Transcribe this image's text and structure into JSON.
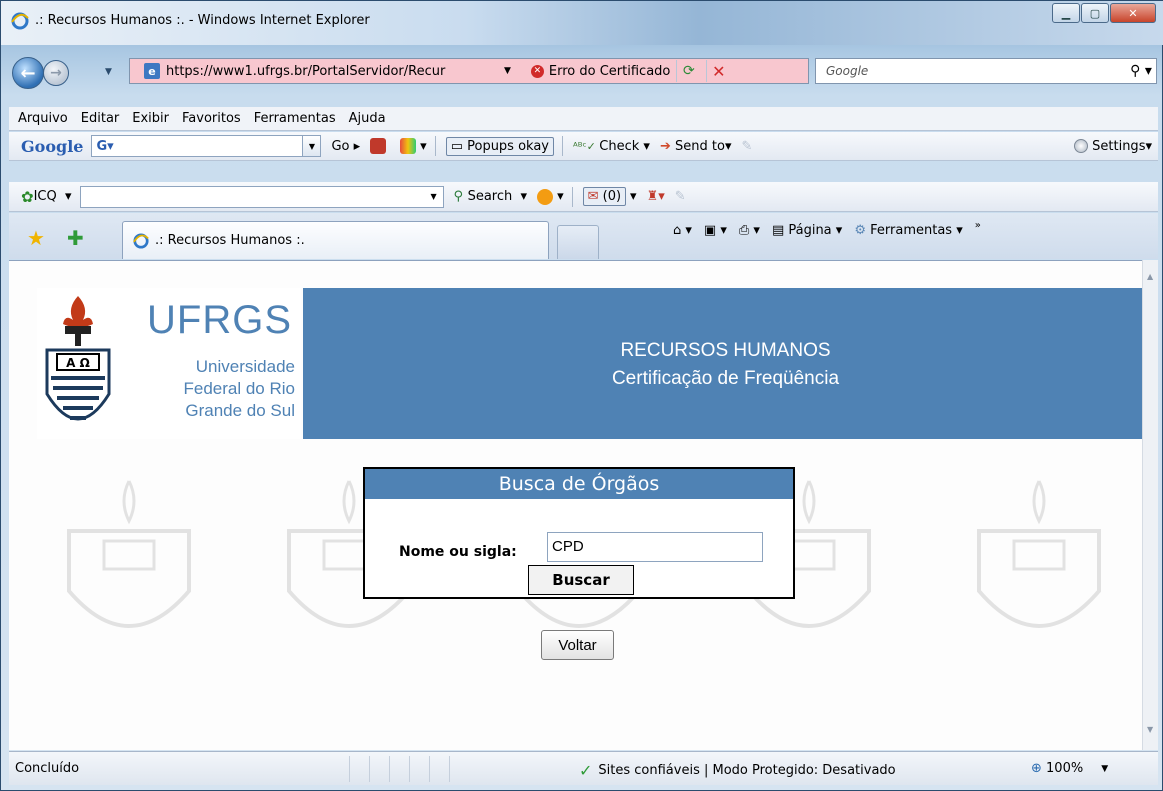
{
  "window": {
    "title": ".: Recursos Humanos :. - Windows Internet Explorer"
  },
  "address_bar": {
    "url": "https://www1.ufrgs.br/PortalServidor/Recur",
    "certificate_error": "Erro do Certificado",
    "search_placeholder": "Google"
  },
  "menu": {
    "items": [
      "Arquivo",
      "Editar",
      "Exibir",
      "Favoritos",
      "Ferramentas",
      "Ajuda"
    ]
  },
  "google_toolbar": {
    "logo": "Google",
    "go_label": "Go",
    "popups": "Popups okay",
    "check": "Check",
    "send_to": "Send to",
    "settings": "Settings"
  },
  "icq_toolbar": {
    "label": "ICQ",
    "search": "Search",
    "counter": "(0)"
  },
  "tabs": {
    "active": ".: Recursos Humanos :."
  },
  "command_bar": {
    "page": "Página",
    "tools": "Ferramentas"
  },
  "header": {
    "logo_text": "UFRGS",
    "logo_sub": [
      "Universidade",
      "Federal do Rio",
      "Grande do Sul"
    ],
    "line1": "RECURSOS HUMANOS",
    "line2": "Certificação de Freqüência"
  },
  "search_panel": {
    "title": "Busca de Órgãos",
    "label": "Nome ou sigla:",
    "value": "CPD",
    "button": "Buscar"
  },
  "back_button": "Voltar",
  "status_bar": {
    "status": "Concluído",
    "zone": "Sites confiáveis | Modo Protegido: Desativado",
    "zoom": "100%"
  },
  "colors": {
    "brand_blue": "#4f82b4",
    "cert_error_bg": "#f8c7cf"
  }
}
